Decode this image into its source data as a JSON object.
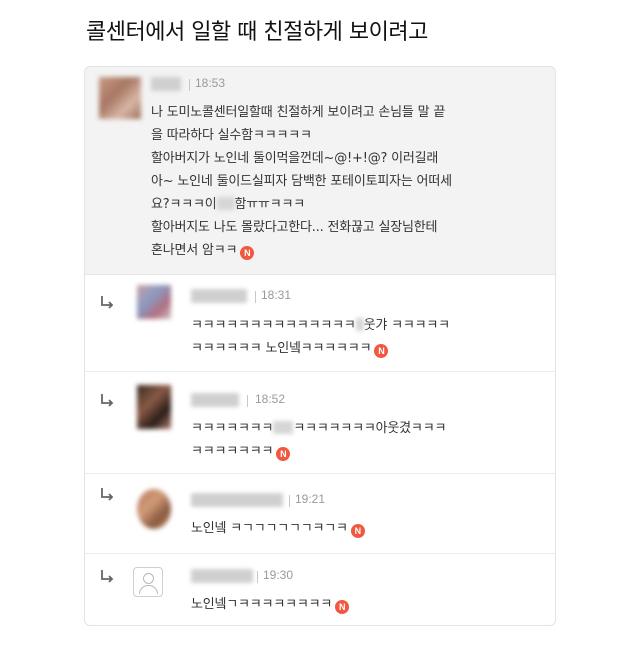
{
  "headline": "콜센터에서 일할 때 친절하게 보이려고",
  "main_comment": {
    "time": "18:53",
    "lines": [
      "나 도미노콜센터일할때 친절하게 보이려고 손님들 말 끝",
      "을 따라하다 실수함ㅋㅋㅋㅋㅋ",
      "할아버지가 노인네 둘이먹을껀데~@!+!@? 이러길래",
      "아~ 노인네 둘이드실피자 담백한 포테이토피자는 어떠세",
      "요?ㅋㅋㅋ이",
      "함ㅠㅠㅋㅋㅋ",
      "할아버지도 나도 몰랐다고한다... 전화끊고 실장님한테",
      "혼나면서 암ㅋㅋ"
    ],
    "badge": "N"
  },
  "replies": [
    {
      "time": "18:31",
      "line1a": "ㅋㅋㅋㅋㅋㅋㅋㅋㅋㅋㅋㅋㅋㅋ",
      "line1b": "웃갸 ㅋㅋㅋㅋㅋ",
      "line2": "ㅋㅋㅋㅋㅋㅋ 노인넼ㅋㅋㅋㅋㅋㅋ",
      "badge": "N"
    },
    {
      "time": "18:52",
      "line1a": "ㅋㅋㅋㅋㅋㅋㅋ",
      "line1b": "ㅋㅋㅋㅋㅋㅋㅋ아웃겼ㅋㅋㅋ",
      "line2": "ㅋㅋㅋㅋㅋㅋㅋ",
      "badge": "N"
    },
    {
      "time": "19:21",
      "line1": "노인넼 ㅋㄱㄱㄱㄱㄱㄱㅋㄱㅋ",
      "badge": "N"
    },
    {
      "time": "19:30",
      "line1": "노인넼ㄱㅋㅋㅋㅋㅋㅋㅋㅋ",
      "badge": "N"
    }
  ],
  "colors": {
    "badge": "#f1583f",
    "main_bg": "#f3f3f3",
    "time": "#9a9a9a"
  }
}
